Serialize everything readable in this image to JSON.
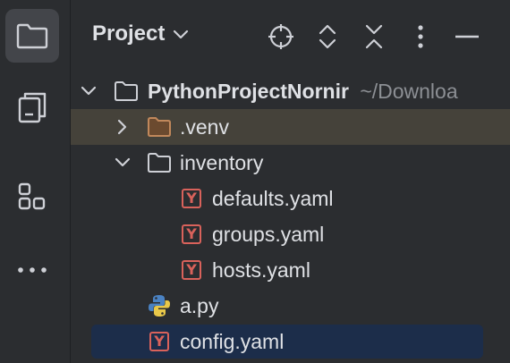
{
  "panel": {
    "title": "Project"
  },
  "tree": {
    "root": {
      "name": "PythonProjectNornir",
      "path": "~/Downloa"
    },
    "venv": {
      "name": ".venv"
    },
    "inventory": {
      "name": "inventory"
    },
    "defaults": {
      "name": "defaults.yaml",
      "icon_letter": "Y"
    },
    "groups": {
      "name": "groups.yaml",
      "icon_letter": "Y"
    },
    "hosts": {
      "name": "hosts.yaml",
      "icon_letter": "Y"
    },
    "apy": {
      "name": "a.py"
    },
    "config": {
      "name": "config.yaml",
      "icon_letter": "Y"
    }
  },
  "colors": {
    "background": "#2b2d30",
    "row_highlight": "#45423a",
    "row_selected": "#1c2d4a",
    "yaml_icon": "#d9625b",
    "venv_folder": "#c1885b"
  },
  "icons": {
    "toolstrip": [
      "folder-icon",
      "structure-icon",
      "plugins-icon",
      "more-icon"
    ],
    "header": [
      "locate-icon",
      "expand-all-icon",
      "collapse-all-icon",
      "options-icon",
      "hide-icon"
    ]
  }
}
